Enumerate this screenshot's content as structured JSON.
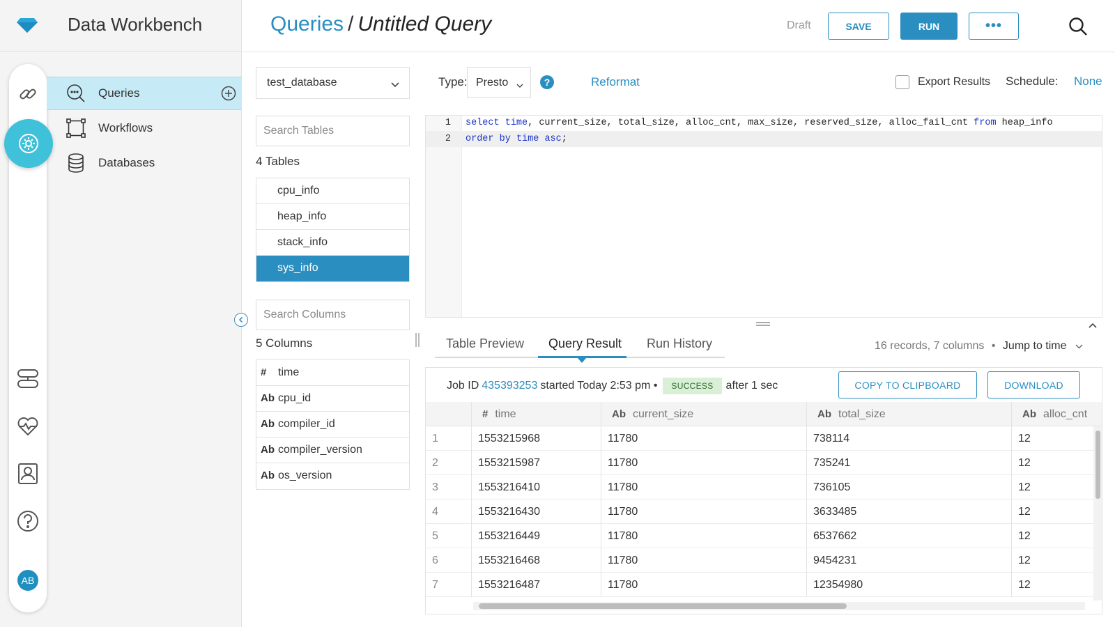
{
  "app": {
    "title": "Data Workbench"
  },
  "nav": {
    "items": [
      {
        "label": "Queries",
        "icon": "query-search-icon",
        "active": true
      },
      {
        "label": "Workflows",
        "icon": "workflow-icon",
        "active": false
      },
      {
        "label": "Databases",
        "icon": "database-icon",
        "active": false
      }
    ],
    "add_icon": "plus-circle-icon"
  },
  "rail": {
    "icons": [
      "link-icon",
      "settings-gear-icon",
      "server-icon",
      "health-heart-icon",
      "contact-card-icon",
      "help-icon"
    ],
    "avatar_initials": "AB"
  },
  "header": {
    "breadcrumb_parent": "Queries",
    "breadcrumb_separator": "/",
    "breadcrumb_current": "Untitled Query",
    "status": "Draft",
    "save_label": "SAVE",
    "run_label": "RUN",
    "more_label": "•••"
  },
  "browser": {
    "database": "test_database",
    "search_tables_placeholder": "Search Tables",
    "tables_count": "4 Tables",
    "tables": [
      "cpu_info",
      "heap_info",
      "stack_info",
      "sys_info"
    ],
    "selected_table": "sys_info",
    "search_columns_placeholder": "Search Columns",
    "columns_count": "5 Columns",
    "columns": [
      {
        "type": "#",
        "name": "time"
      },
      {
        "type": "Ab",
        "name": "cpu_id"
      },
      {
        "type": "Ab",
        "name": "compiler_id"
      },
      {
        "type": "Ab",
        "name": "compiler_version"
      },
      {
        "type": "Ab",
        "name": "os_version"
      }
    ]
  },
  "editor": {
    "type_label": "Type:",
    "type_value": "Presto",
    "help_label": "?",
    "reformat_label": "Reformat",
    "export_label": "Export Results",
    "export_checked": false,
    "schedule_label": "Schedule:",
    "schedule_value": "None",
    "line_numbers": [
      "1",
      "2"
    ]
  },
  "tabs": {
    "items": [
      "Table Preview",
      "Query Result",
      "Run History"
    ],
    "active": "Query Result"
  },
  "results": {
    "summary": "16 records, 7 columns",
    "bullet": "•",
    "jump_label": "Jump to time",
    "job_prefix": "Job ID",
    "job_id": "435393253",
    "job_started": "started Today 2:53 pm •",
    "status_badge": "SUCCESS",
    "job_duration": "after 1 sec",
    "copy_label": "COPY TO CLIPBOARD",
    "download_label": "DOWNLOAD",
    "columns": [
      {
        "type": "#",
        "name": "time"
      },
      {
        "type": "Ab",
        "name": "current_size"
      },
      {
        "type": "Ab",
        "name": "total_size"
      },
      {
        "type": "Ab",
        "name": "alloc_cnt"
      }
    ],
    "rows": [
      [
        "1",
        "1553215968",
        "11780",
        "738114",
        "12"
      ],
      [
        "2",
        "1553215987",
        "11780",
        "735241",
        "12"
      ],
      [
        "3",
        "1553216410",
        "11780",
        "736105",
        "12"
      ],
      [
        "4",
        "1553216430",
        "11780",
        "3633485",
        "12"
      ],
      [
        "5",
        "1553216449",
        "11780",
        "6537662",
        "12"
      ],
      [
        "6",
        "1553216468",
        "11780",
        "9454231",
        "12"
      ],
      [
        "7",
        "1553216487",
        "11780",
        "12354980",
        "12"
      ]
    ]
  },
  "colors": {
    "accent": "#2a8ec0",
    "teal": "#3fc1d9",
    "active_nav": "#c7ebf6",
    "success_bg": "#d9efd6"
  }
}
